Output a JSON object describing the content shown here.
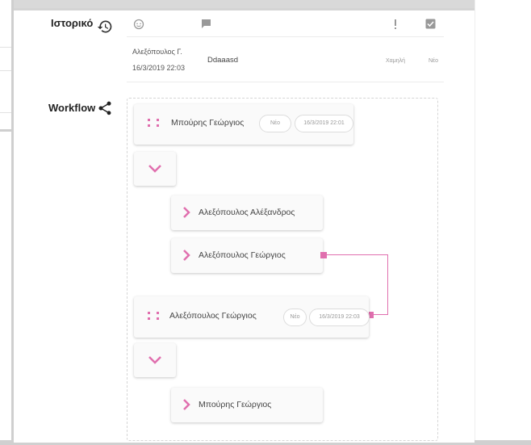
{
  "sections": {
    "history_label": "Ιστορικό",
    "workflow_label": "Workflow"
  },
  "history": {
    "header_icons": [
      "face-icon",
      "comment-icon",
      "priority-icon",
      "status-check-icon"
    ],
    "entries": [
      {
        "author": "Αλεξόπουλος Γ.",
        "date": "16/3/2019 22:03",
        "comment": "Ddaaasd",
        "priority": "Χαμηλή",
        "status": "Νέο"
      }
    ]
  },
  "workflow": {
    "accent_color": "#e06fae",
    "steps": [
      {
        "name": "Μπούρης Γεώργιος",
        "status": "Νέο",
        "date": "16/3/2019 22:01",
        "children": [
          "Αλεξόπουλος Αλέξανδρος",
          "Αλεξόπουλος Γεώργιος"
        ]
      },
      {
        "name": "Αλεξόπουλος Γεώργιος",
        "status": "Νέο",
        "date": "16/3/2019 22:03",
        "children": [
          "Μπούρης Γεώργιος"
        ]
      }
    ]
  }
}
